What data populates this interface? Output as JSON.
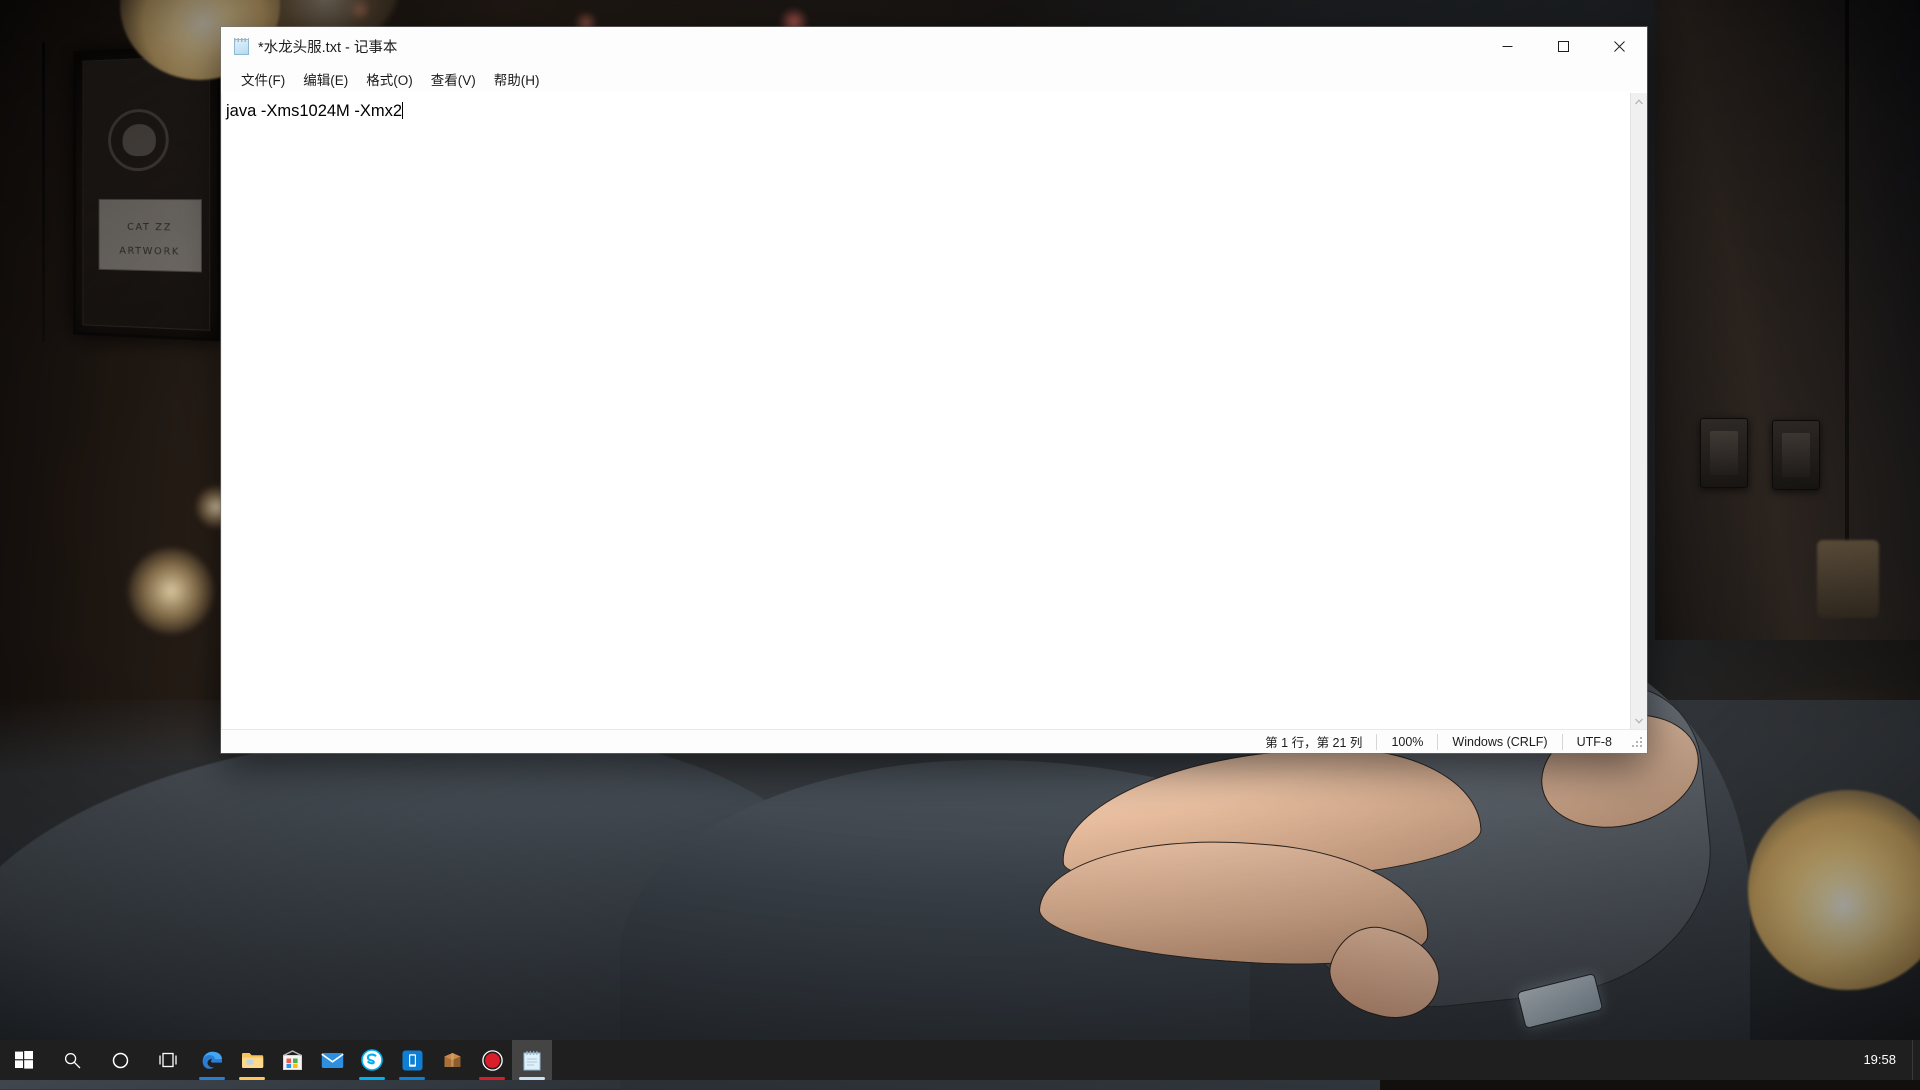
{
  "window": {
    "title": "*水龙头服.txt - 记事本",
    "icon": "notepad-icon",
    "controls": {
      "minimize": "—",
      "maximize": "□",
      "close": "✕"
    }
  },
  "menubar": {
    "items": [
      {
        "label": "文件(F)",
        "name": "menu-file"
      },
      {
        "label": "编辑(E)",
        "name": "menu-edit"
      },
      {
        "label": "格式(O)",
        "name": "menu-format"
      },
      {
        "label": "查看(V)",
        "name": "menu-view"
      },
      {
        "label": "帮助(H)",
        "name": "menu-help"
      }
    ]
  },
  "editor": {
    "content": "java -Xms1024M -Xmx2",
    "caret_visible": true
  },
  "scrollbar": {
    "up_arrow": "⌃",
    "down_arrow": "⌄"
  },
  "statusbar": {
    "cursor_position": "第 1 行，第 21 列",
    "zoom": "100%",
    "line_ending": "Windows (CRLF)",
    "encoding": "UTF-8"
  },
  "taskbar": {
    "clock": "19:58",
    "system_buttons": [
      {
        "name": "start-button",
        "icon": "windows-logo-icon"
      },
      {
        "name": "search-button",
        "icon": "search-icon"
      },
      {
        "name": "cortana-button",
        "icon": "cortana-circle-icon"
      },
      {
        "name": "task-view-button",
        "icon": "task-view-icon"
      }
    ],
    "apps": [
      {
        "name": "taskbar-app-edge",
        "icon": "edge-icon",
        "color": "#2b7cd3",
        "running": true,
        "active": false
      },
      {
        "name": "taskbar-app-file-explorer",
        "icon": "folder-icon",
        "color": "#ffc75a",
        "running": true,
        "active": false
      },
      {
        "name": "taskbar-app-store",
        "icon": "store-icon",
        "color": "#f0f0f0",
        "running": false,
        "active": false
      },
      {
        "name": "taskbar-app-mail",
        "icon": "mail-icon",
        "color": "#2e8fe0",
        "running": false,
        "active": false
      },
      {
        "name": "taskbar-app-skype",
        "icon": "skype-s-icon",
        "color": "#00aff0",
        "running": true,
        "active": false
      },
      {
        "name": "taskbar-app-phone",
        "icon": "phone-icon",
        "color": "#0d7fd6",
        "running": true,
        "active": false
      },
      {
        "name": "taskbar-app-package",
        "icon": "package-box-icon",
        "color": "#b4793f",
        "running": false,
        "active": false
      },
      {
        "name": "taskbar-app-recorder",
        "icon": "record-circle-icon",
        "color": "#d91e2a",
        "running": true,
        "active": false
      },
      {
        "name": "taskbar-app-notepad",
        "icon": "notepad-icon",
        "color": "#c9e4f6",
        "running": true,
        "active": true
      }
    ]
  },
  "desktop": {
    "wallpaper_description": "dark bedroom anime illustration with glowing bulb",
    "poster_line1": "CAT ZZ",
    "poster_line2": "ARTWORK"
  }
}
